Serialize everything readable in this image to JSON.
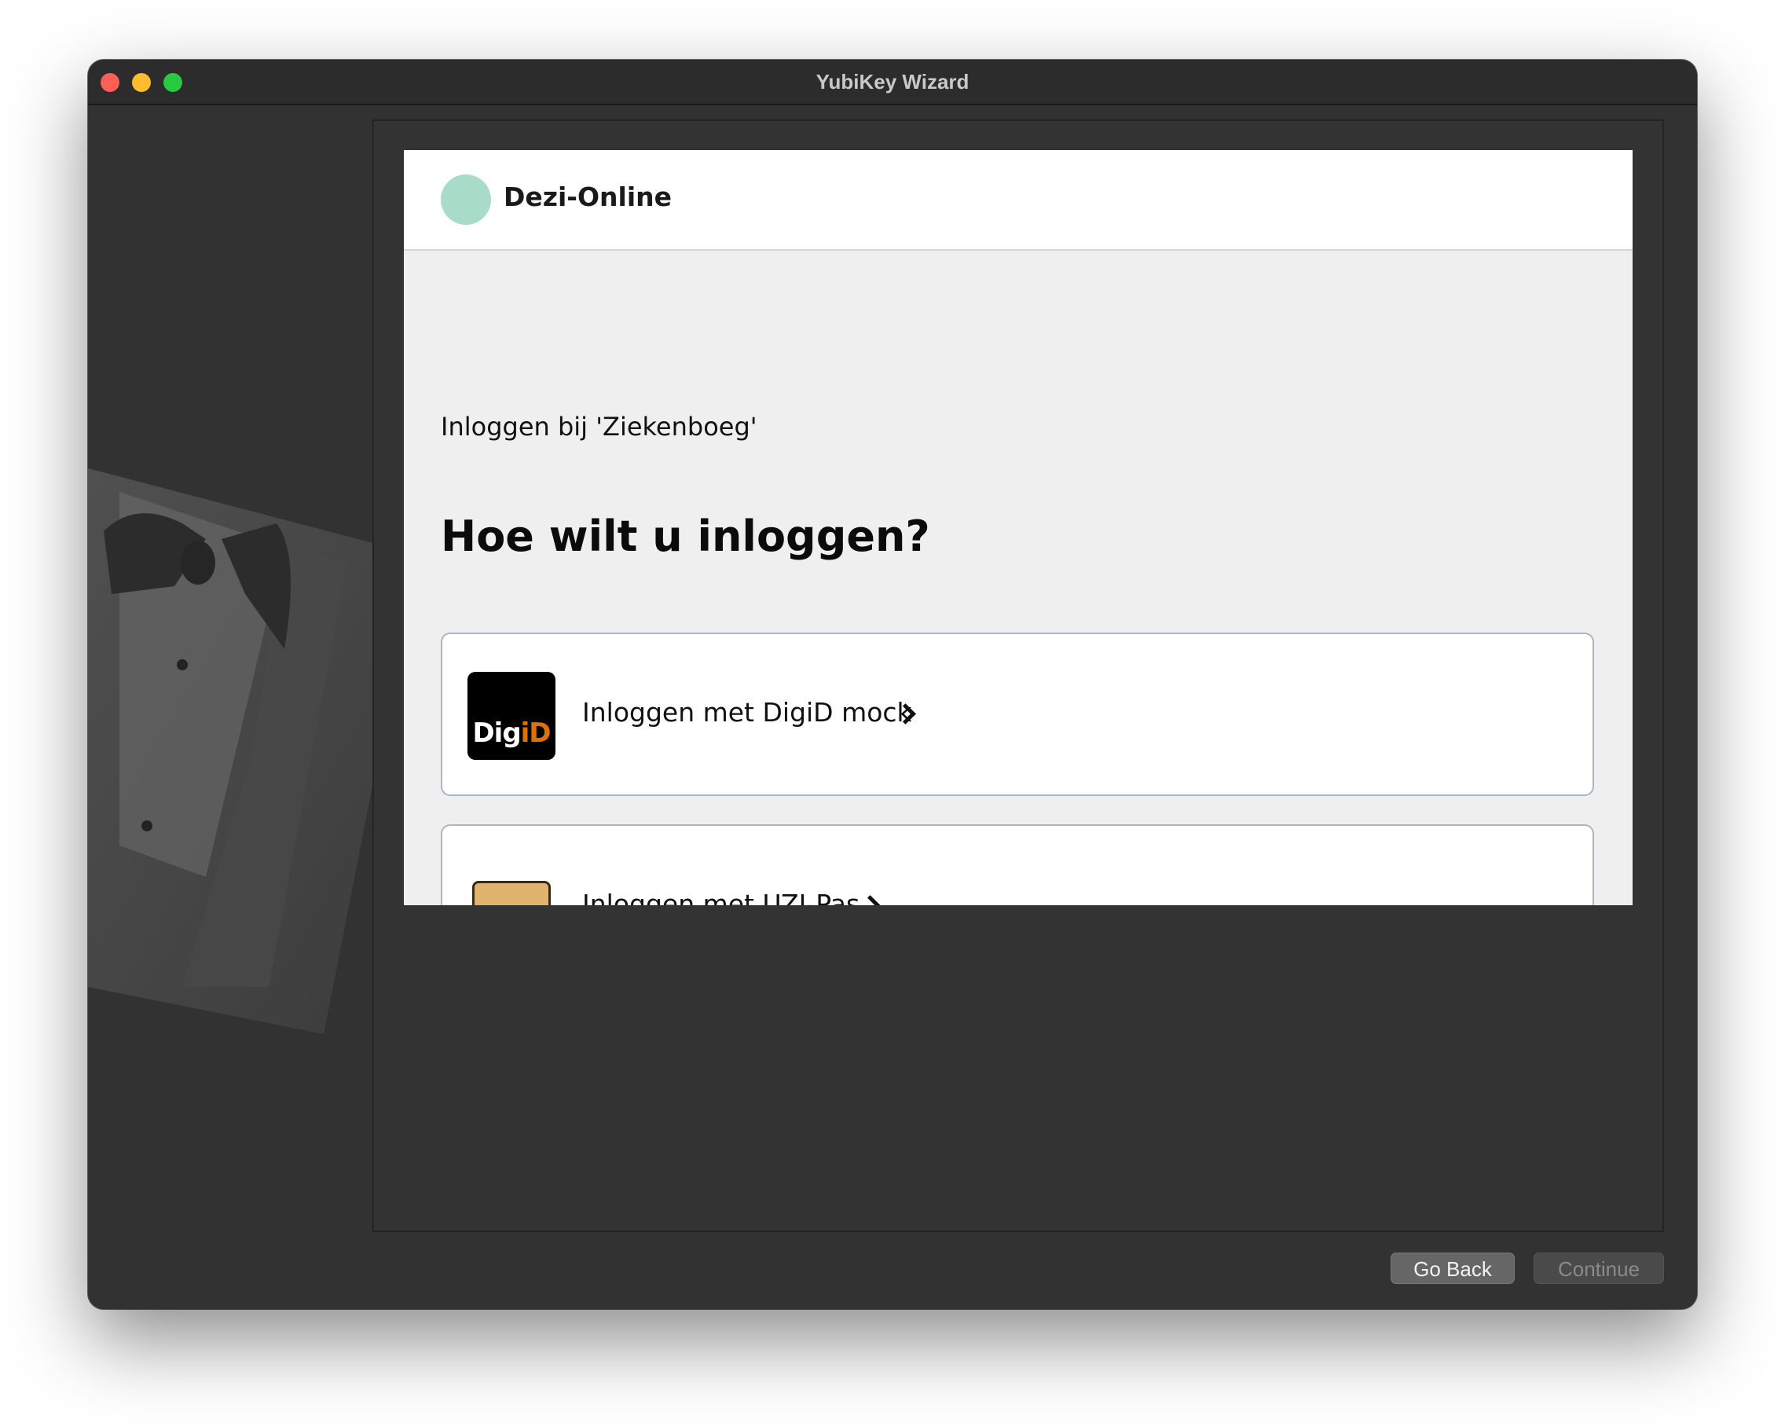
{
  "window": {
    "title": "YubiKey Wizard"
  },
  "site": {
    "brand": "Dezi-Online",
    "subtitle": "Inloggen bij 'Ziekenboeg'",
    "heading": "Hoe wilt u inloggen?"
  },
  "options": [
    {
      "logo_text_main": "Dig",
      "logo_text_accent": "iD",
      "label": "Inloggen met DigiD mock"
    },
    {
      "label": "Inloggen met UZI-Pas"
    }
  ],
  "buttons": {
    "back": "Go Back",
    "continue": "Continue"
  },
  "colors": {
    "digid_accent": "#e17000",
    "logo_circle": "#a8dcc9",
    "close": "#fe5f57",
    "minimize": "#febc2e",
    "maximize": "#28c840"
  }
}
